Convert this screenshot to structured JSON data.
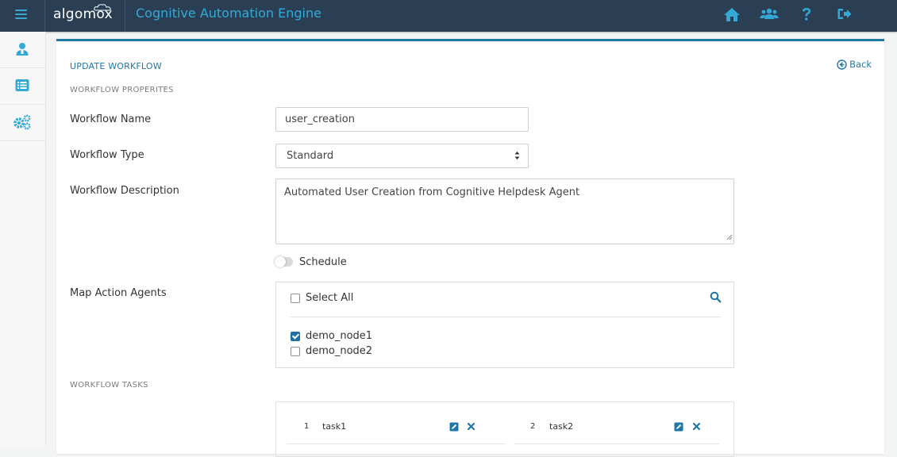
{
  "app": {
    "logo_text": "algomox",
    "title": "Cognitive Automation Engine"
  },
  "header_icons": [
    "home-icon",
    "users-icon",
    "help-icon",
    "sign-out-icon"
  ],
  "sidebar_icons": [
    "user-icon",
    "list-icon",
    "gears-icon"
  ],
  "page": {
    "heading": "UPDATE WORKFLOW",
    "back_label": "Back",
    "properties_heading": "WORKFLOW PROPERITES",
    "tasks_heading": "WORKFLOW TASKS"
  },
  "form": {
    "name_label": "Workflow Name",
    "name_value": "user_creation",
    "type_label": "Workflow Type",
    "type_value": "Standard",
    "description_label": "Workflow Description",
    "description_value": "Automated User Creation from Cognitive Helpdesk Agent",
    "schedule_label": "Schedule",
    "schedule_on": false,
    "agents_label": "Map Action Agents",
    "select_all_label": "Select All",
    "agents": [
      {
        "name": "demo_node1",
        "checked": true
      },
      {
        "name": "demo_node2",
        "checked": false
      }
    ]
  },
  "tasks": [
    {
      "num": "1",
      "name": "task1"
    },
    {
      "num": "2",
      "name": "task2"
    }
  ],
  "colors": {
    "topbar": "#2a3f54",
    "accent": "#35a9d6",
    "primary": "#1f77a8",
    "checkbox": "#1f6fa0"
  }
}
